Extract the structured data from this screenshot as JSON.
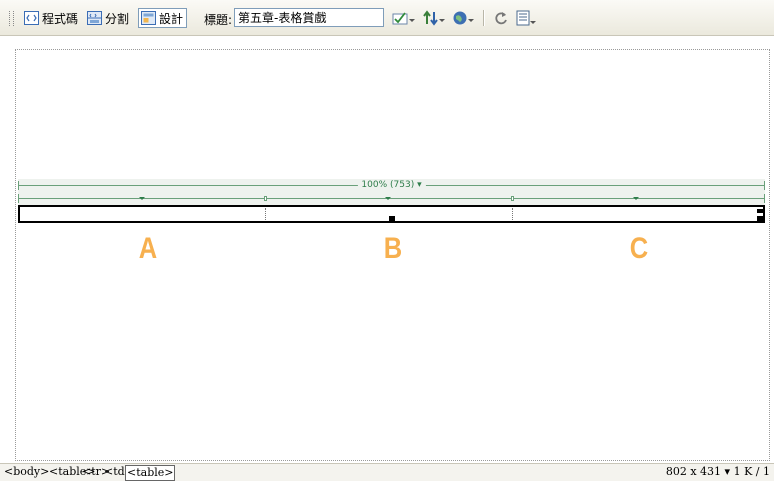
{
  "toolbar": {
    "code_label": "程式碼",
    "split_label": "分割",
    "design_label": "設計",
    "title_label": "標題:",
    "title_value": "第五章-表格賞戲"
  },
  "ruler": {
    "width_label": "100% (753) ▾"
  },
  "columns": [
    "A",
    "B",
    "C"
  ],
  "statusbar": {
    "tags": [
      "<body>",
      "<table>",
      "<tr>",
      "<td>",
      "<table>"
    ],
    "size": "802 x 431",
    "size_arrow": "▾",
    "file_info": "1 K / 1"
  },
  "colors": {
    "accent_letter": "#f7b04f",
    "ruler_green": "#2e7d4a"
  }
}
